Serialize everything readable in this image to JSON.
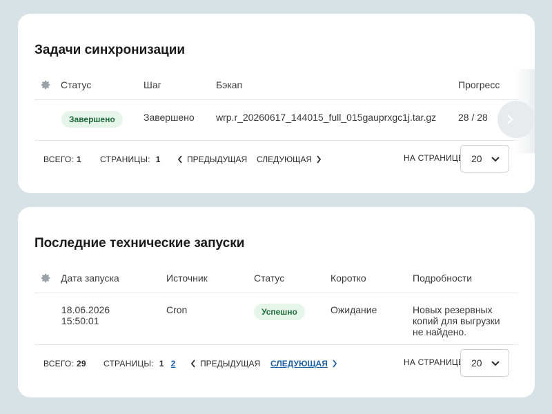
{
  "sync": {
    "title": "Задачи синхронизации",
    "columns": [
      "Статус",
      "Шаг",
      "Бэкап",
      "Прогресс"
    ],
    "rows": [
      {
        "status": "Завершено",
        "step": "Завершено",
        "backup": "wrp.r_20260617_144015_full_015gauprxgc1j.tar.gz",
        "progress": "28 / 28"
      }
    ],
    "footer": {
      "total_label": "Всего:",
      "total_value": "1",
      "pages_label": "Страницы:",
      "pages": [
        "1"
      ],
      "prev_label": "Предыдущая",
      "next_label": "Следующая",
      "per_page_label": "На странице:",
      "per_page_value": "20"
    }
  },
  "runs": {
    "title": "Последние технические запуски",
    "columns": [
      "Дата запуска",
      "Источник",
      "Статус",
      "Коротко",
      "Подробности"
    ],
    "rows": [
      {
        "date": "18.06.2026",
        "time": "15:50:01",
        "source": "Cron",
        "status": "Успешно",
        "short": "Ожидание",
        "details_line1": "Новых резервных",
        "details_line2": "копий для выгрузки",
        "details_line3": "не найдено."
      }
    ],
    "footer": {
      "total_label": "Всего:",
      "total_value": "29",
      "pages_label": "Страницы:",
      "pages": [
        "1",
        "2"
      ],
      "prev_label": "Предыдущая",
      "next_label": "Следующая",
      "per_page_label": "На странице:",
      "per_page_value": "20"
    }
  },
  "colors": {
    "background": "#d6e2e5",
    "badge_bg": "#e6f5ea",
    "badge_text": "#1f6b3a",
    "link": "#1a5ea8"
  },
  "icons": {
    "settings": "gear-icon",
    "scroll": "chevron-right-icon",
    "select": "chevron-down-icon"
  }
}
